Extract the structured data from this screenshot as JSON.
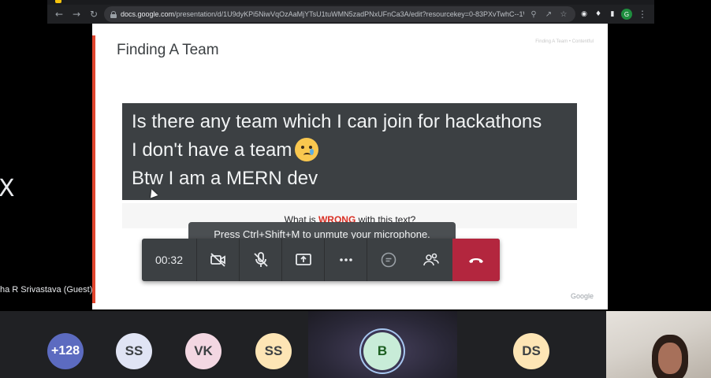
{
  "browser": {
    "url_host": "docs.google.com",
    "url_path": "/presentation/d/1U9dyKPi5NiwVqOzAaMjYTsU1tuWMN5zadPNxUFnCa3A/edit?resourcekey=0-83PXvTwhC--1WHRFyet0...",
    "profile_initial": "G",
    "icons": [
      "back-icon",
      "forward-icon",
      "reload-icon",
      "lock-icon",
      "zoom-icon",
      "share-icon",
      "star-icon",
      "extension-icon",
      "puzzle-icon",
      "sidepanel-icon",
      "profile-avatar",
      "menu-icon"
    ]
  },
  "slide": {
    "title": "Finding A Team",
    "crumb": "Finding A Team • Contentful",
    "chat_lines": [
      "Is there any team which I can join for hackathons",
      "I don't have a team",
      "Btw I am a MERN dev"
    ],
    "emoji": "crying-face-emoji",
    "question_pre": "What is ",
    "question_wrong": "WRONG",
    "question_post": " with this text?",
    "brand": "Google",
    "accent_color": "#e0452e"
  },
  "toast": {
    "message": "Press Ctrl+Shift+M to unmute your microphone."
  },
  "callbar": {
    "timer": "00:32",
    "buttons": [
      "camera-off-icon",
      "mic-off-icon",
      "present-screen-icon",
      "more-options-icon",
      "chat-icon",
      "participants-icon",
      "hang-up-icon"
    ],
    "hangup_color": "#b3263e"
  },
  "edge": {
    "x_glyph": "X",
    "presenter_name": "ha R Srivastava (Guest)"
  },
  "participants": {
    "more_count": "+128",
    "tiles": [
      {
        "initials": "SS",
        "color": "#e0e4f4"
      },
      {
        "initials": "VK",
        "color": "#f3d7e2"
      },
      {
        "initials": "SS",
        "color": "#fde5b5"
      },
      {
        "initials": "B",
        "color": "#c8ecd8"
      },
      {
        "initials": "DS",
        "color": "#fde5b5"
      }
    ],
    "self_video": "participant-video"
  }
}
